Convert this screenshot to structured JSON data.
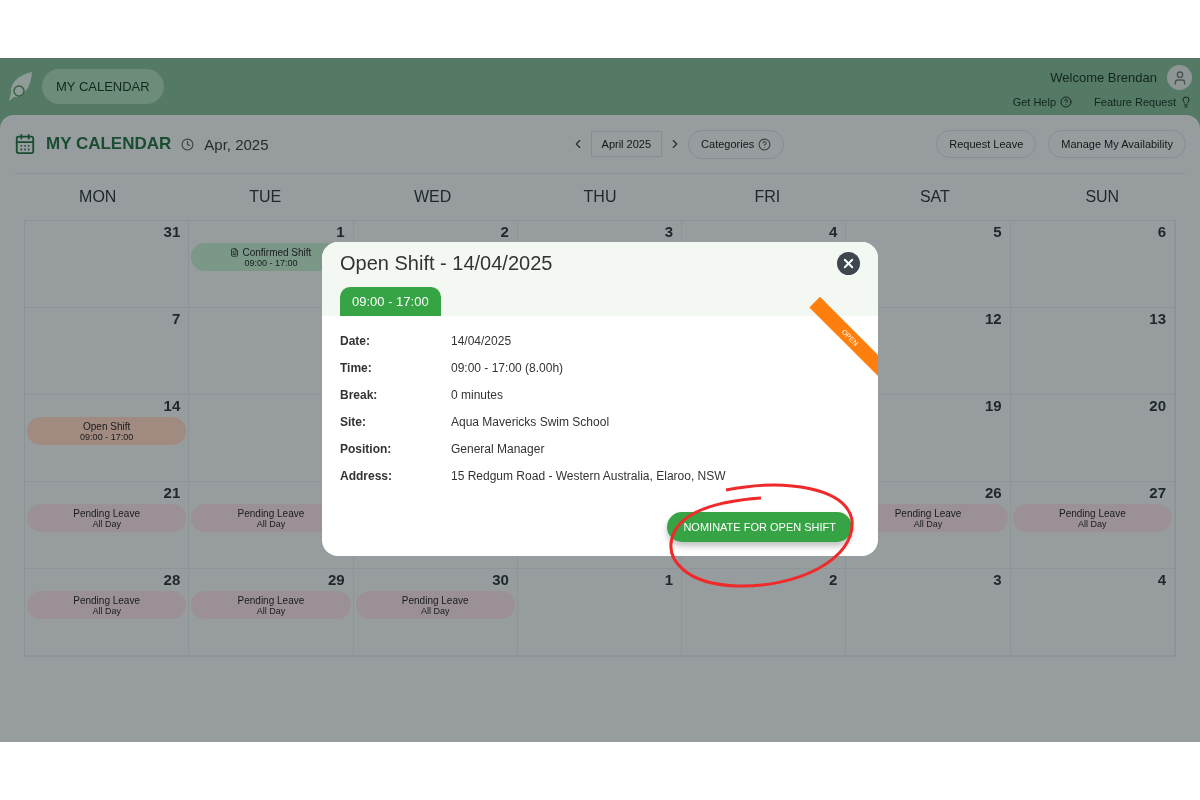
{
  "header": {
    "nav_button": "MY CALENDAR",
    "welcome": "Welcome Brendan",
    "links": [
      {
        "label": "Get Help",
        "kind": "help"
      },
      {
        "label": "Feature Request",
        "kind": "idea"
      }
    ]
  },
  "toolbar": {
    "title": "MY CALENDAR",
    "period": "Apr, 2025",
    "month": "April 2025",
    "categories": "Categories",
    "actions": [
      "Request Leave",
      "Manage My Availability"
    ]
  },
  "weekdays": [
    "MON",
    "TUE",
    "WED",
    "THU",
    "FRI",
    "SAT",
    "SUN"
  ],
  "weeks": [
    {
      "start": [
        {
          "day": "31"
        },
        {
          "day": "1",
          "events": [
            {
              "kind": "confirmed",
              "title": "Confirmed Shift",
              "time": "09:00 - 17:00"
            }
          ]
        },
        {
          "day": "2"
        },
        {
          "day": "3"
        },
        {
          "day": "4"
        },
        {
          "day": "5"
        },
        {
          "day": "6"
        }
      ]
    },
    {
      "start": [
        {
          "day": "7"
        }
      ],
      "end": [
        {
          "day": "12"
        },
        {
          "day": "13"
        }
      ]
    },
    {
      "start": [
        {
          "day": "14",
          "events": [
            {
              "kind": "open",
              "title": "Open Shift",
              "time": "09:00 - 17:00"
            }
          ]
        }
      ],
      "end": [
        {
          "day": "19"
        },
        {
          "day": "20"
        }
      ]
    },
    {
      "start": [
        {
          "day": "21",
          "events": [
            {
              "kind": "pending",
              "title": "Pending Leave",
              "time": "All Day"
            }
          ]
        },
        {
          "events": [
            {
              "kind": "pending",
              "title": "Pending Leave",
              "time": "All Day"
            }
          ]
        }
      ],
      "end": [
        {
          "day": "26",
          "events": [
            {
              "kind": "pending",
              "title": "Pending Leave",
              "time": "All Day"
            }
          ]
        },
        {
          "day": "27",
          "events": [
            {
              "kind": "pending",
              "title": "Pending Leave",
              "time": "All Day"
            }
          ]
        }
      ]
    },
    {
      "start": [
        {
          "day": "28",
          "events": [
            {
              "kind": "pending",
              "title": "Pending Leave",
              "time": "All Day"
            }
          ]
        },
        {
          "day": "29",
          "events": [
            {
              "kind": "pending",
              "title": "Pending Leave",
              "time": "All Day"
            }
          ]
        },
        {
          "day": "30",
          "events": [
            {
              "kind": "pending",
              "title": "Pending Leave",
              "time": "All Day"
            }
          ]
        },
        {
          "day": "1"
        },
        {
          "day": "2"
        },
        {
          "day": "3"
        },
        {
          "day": "4"
        }
      ]
    }
  ],
  "modal": {
    "title": "Open Shift - 14/04/2025",
    "tab": "09:00 - 17:00",
    "ribbon": "OPEN",
    "fields": [
      {
        "label": "Date:",
        "value": "14/04/2025"
      },
      {
        "label": "Time:",
        "value": "09:00 - 17:00 (8.00h)"
      },
      {
        "label": "Break:",
        "value": "0 minutes"
      },
      {
        "label": "Site:",
        "value": "Aqua Mavericks Swim School"
      },
      {
        "label": "Position:",
        "value": "General Manager"
      },
      {
        "label": "Address:",
        "value": "15 Redgum Road - Western Australia, Elaroo, NSW"
      }
    ],
    "button": "NOMINATE FOR OPEN SHIFT"
  }
}
